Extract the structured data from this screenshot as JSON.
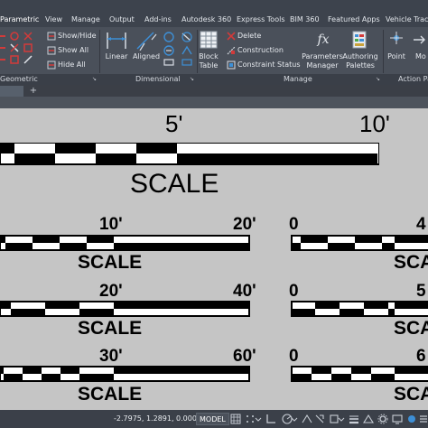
{
  "ribbon_tabs": [
    "Parametric",
    "View",
    "Manage",
    "Output",
    "Add-ins",
    "Autodesk 360",
    "Express Tools",
    "BIM 360",
    "Featured Apps",
    "Vehicle Tracking"
  ],
  "active_tab": "Parametric",
  "geometric_panel": {
    "title": "Geometric",
    "show_hide": "Show/Hide",
    "show_all": "Show All",
    "hide_all": "Hide All"
  },
  "dimensional_panel": {
    "title": "Dimensional",
    "linear": "Linear",
    "aligned": "Aligned"
  },
  "manage_panel": {
    "title": "Manage",
    "block_table_line1": "Block",
    "block_table_line2": "Table",
    "delete": "Delete",
    "construction": "Construction",
    "constraint_status": "Constraint Status",
    "parameters_line1": "Parameters",
    "parameters_line2": "Manager",
    "authoring_line1": "Authoring",
    "authoring_line2": "Palettes"
  },
  "action_panel": {
    "title": "Action Pa",
    "point": "Point",
    "move": "Mo"
  },
  "drawing": {
    "top_scale": {
      "label_mid": "5'",
      "label_end": "10'",
      "word": "SCALE"
    },
    "left_scales": [
      {
        "mid": "10'",
        "end": "20'",
        "word": "SCALE"
      },
      {
        "mid": "20'",
        "end": "40'",
        "word": "SCALE"
      },
      {
        "mid": "30'",
        "end": "60'",
        "word": "SCALE"
      }
    ],
    "right_scales": [
      {
        "zero": "0",
        "end": "4",
        "word": "SCA"
      },
      {
        "zero": "0",
        "end": "5",
        "word": "SCA"
      },
      {
        "zero": "0",
        "end": "6",
        "word": "SCA"
      }
    ]
  },
  "status_bar": {
    "coordinates": "-2.7975, 1.2891, 0.0000",
    "model_button": "MODEL"
  },
  "colors": {
    "ribbon_tabs_bg": "#3d434d",
    "ribbon_bg": "#4a505a",
    "canvas_bg": "#c5c5c5",
    "accent_blue": "#3d8fd6",
    "accent_red": "#d33a3a"
  }
}
